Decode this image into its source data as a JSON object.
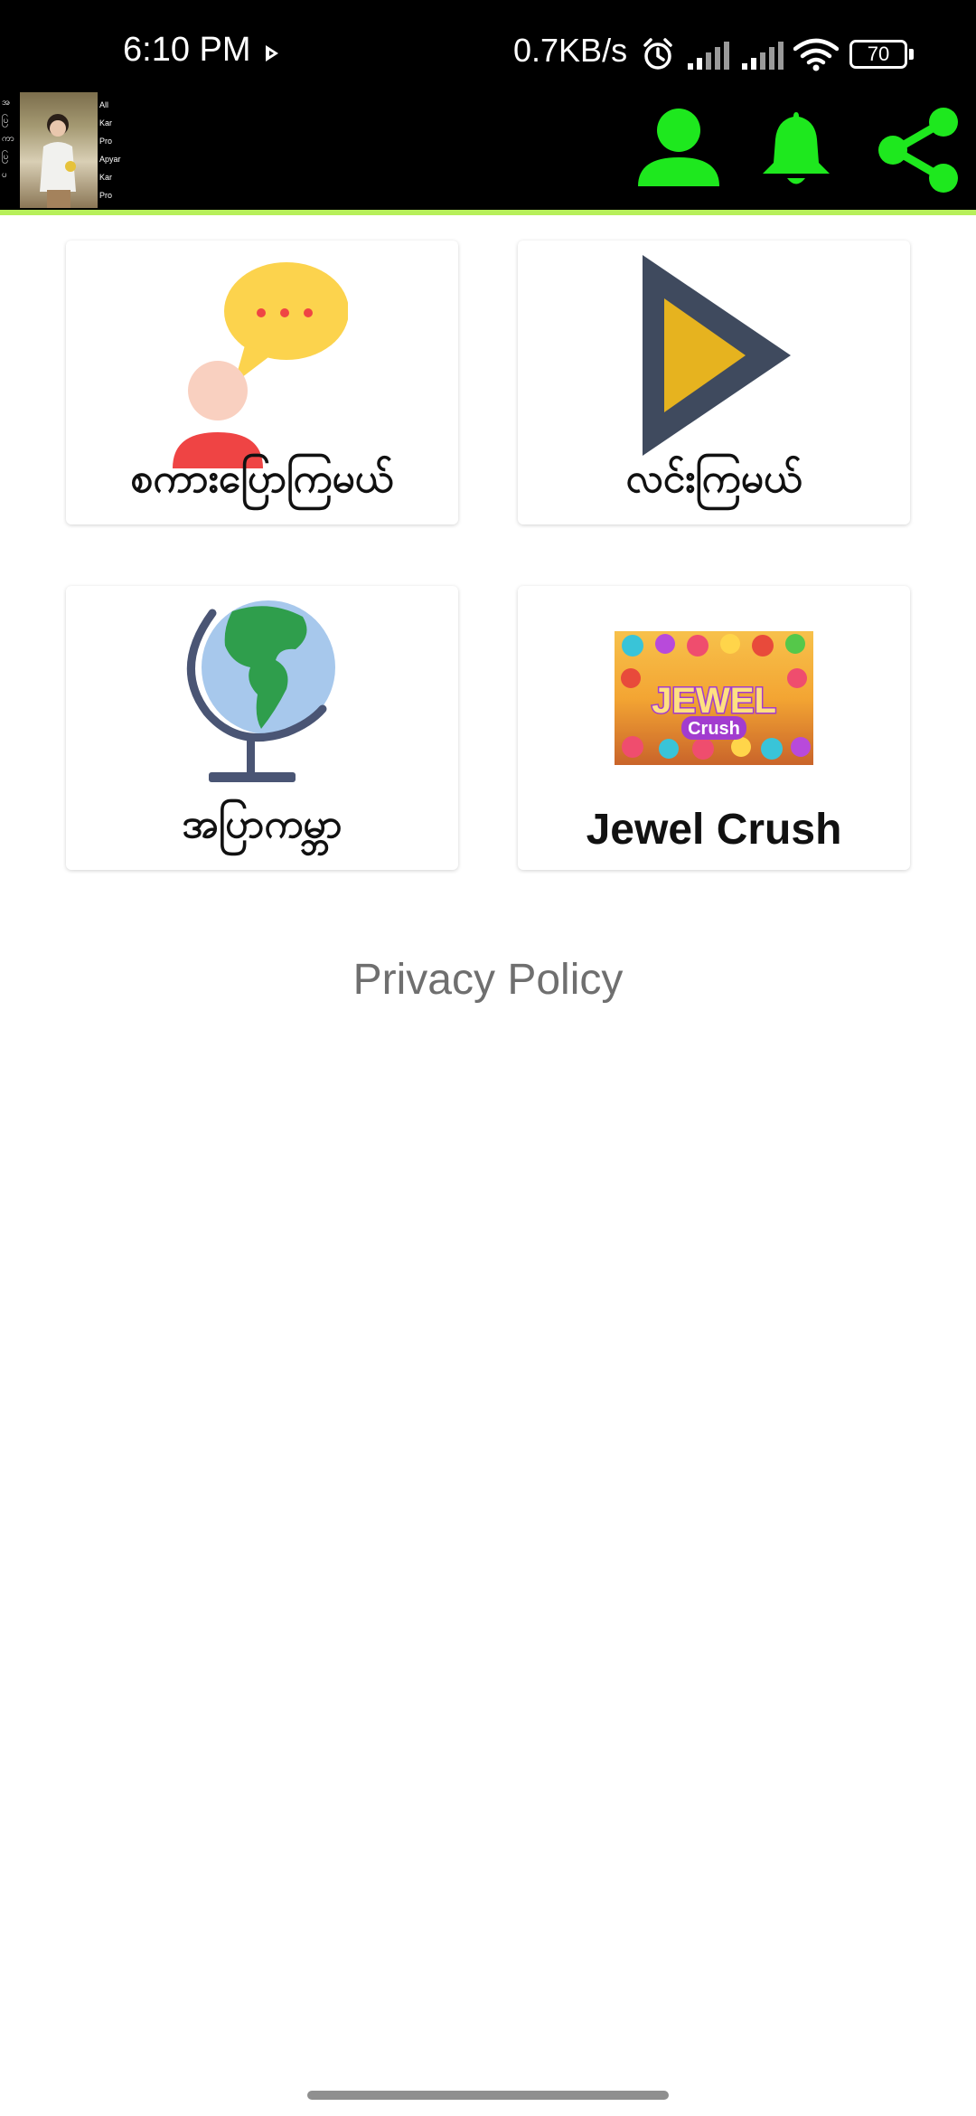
{
  "status_bar": {
    "time": "6:10 PM",
    "network_speed": "0.7KB/s",
    "battery_level": "70",
    "icons": [
      "play-icon",
      "alarm-icon",
      "signal-icon",
      "signal-icon",
      "wifi-icon",
      "battery-icon"
    ]
  },
  "app_bar": {
    "banner_left_labels": [
      "အ",
      "ပြ",
      "ကာ",
      "ပြ",
      "ပ"
    ],
    "banner_right_labels": [
      "All",
      "Kar",
      "Pro",
      "Apyar",
      "Kar",
      "Pro"
    ],
    "icons": [
      "profile-icon",
      "bell-icon",
      "share-icon"
    ],
    "accent_color": "#1ee81e",
    "divider_color": "#b7ef5a"
  },
  "cards": [
    {
      "id": "chat",
      "label": "စကားပြောကြမယ်",
      "icon": "chat-bubble-person-icon"
    },
    {
      "id": "play",
      "label": "လင်းကြမယ်",
      "icon": "play-icon"
    },
    {
      "id": "globe",
      "label": "အပြာကမ္ဘာ",
      "icon": "globe-icon"
    },
    {
      "id": "jewel",
      "label": "Jewel Crush",
      "icon": "jewel-crush-game-thumbnail",
      "thumbnail_text": [
        "JEWEL",
        "Crush"
      ]
    }
  ],
  "privacy_policy": "Privacy Policy"
}
